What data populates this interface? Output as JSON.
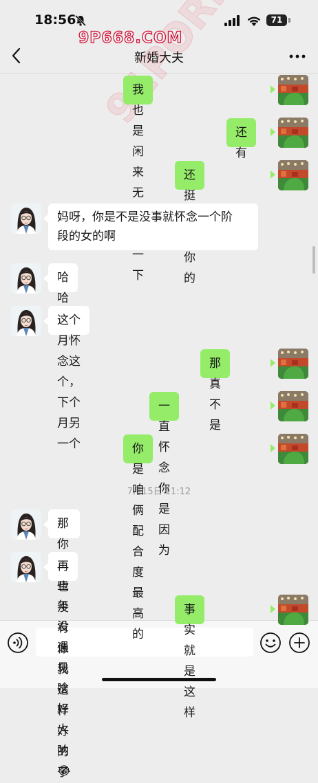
{
  "status_bar": {
    "time": "18:56",
    "battery": "71"
  },
  "watermarks": {
    "top": "9P668.COM",
    "diagonal": "91PORN.COM"
  },
  "nav": {
    "title": "新婚大夫"
  },
  "messages": [
    {
      "side": "right",
      "text": "我也是闲来无事看一下"
    },
    {
      "side": "right",
      "text": "还有"
    },
    {
      "side": "right",
      "text": "还挺怀念你的"
    },
    {
      "side": "left",
      "lines": [
        "妈呀，你是不是没事就怀念一个阶",
        "段的女的啊"
      ]
    },
    {
      "side": "left",
      "text": "哈哈哈"
    },
    {
      "side": "left",
      "text": "这个月怀念这个，下个月另一个"
    },
    {
      "side": "right",
      "text": "那真不是"
    },
    {
      "side": "right",
      "text": "一直怀念你是因为"
    },
    {
      "side": "right",
      "text": "你是咱俩配合度最高的"
    },
    {
      "side": "left",
      "text": "那你这些年没遇见啥好人呐😂"
    },
    {
      "side": "left",
      "text": "再也没有像我这样好的了"
    },
    {
      "side": "right",
      "text": "事实就是这样"
    }
  ],
  "timestamp": "7月15日 11:12",
  "icons": {
    "back": "chevron-left-icon",
    "more": "more-dots-icon",
    "voice": "voice-icon",
    "emoji": "emoji-icon",
    "plus": "plus-icon"
  },
  "colors": {
    "right_bubble": "#95ec69",
    "left_bubble": "#ffffff",
    "background": "#ededed"
  }
}
